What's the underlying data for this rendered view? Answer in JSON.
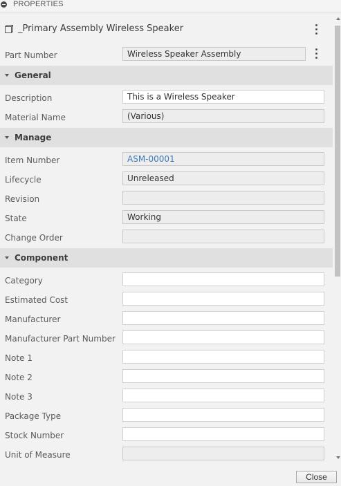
{
  "panel": {
    "title": "PROPERTIES",
    "assembly_name": "_Primary Assembly Wireless Speaker"
  },
  "part_number": {
    "label": "Part Number",
    "value": "Wireless Speaker Assembly"
  },
  "sections": {
    "general": {
      "title": "General",
      "description": {
        "label": "Description",
        "value": "This is a Wireless Speaker"
      },
      "material_name": {
        "label": "Material Name",
        "value": "(Various)"
      }
    },
    "manage": {
      "title": "Manage",
      "item_number": {
        "label": "Item Number",
        "value": "ASM-00001"
      },
      "lifecycle": {
        "label": "Lifecycle",
        "value": "Unreleased"
      },
      "revision": {
        "label": "Revision",
        "value": ""
      },
      "state": {
        "label": "State",
        "value": "Working"
      },
      "change_order": {
        "label": "Change Order",
        "value": ""
      }
    },
    "component": {
      "title": "Component",
      "category": {
        "label": "Category",
        "value": ""
      },
      "estimated_cost": {
        "label": "Estimated Cost",
        "value": ""
      },
      "manufacturer": {
        "label": "Manufacturer",
        "value": ""
      },
      "manufacturer_part_number": {
        "label": "Manufacturer Part Number",
        "value": ""
      },
      "note_1": {
        "label": "Note 1",
        "value": ""
      },
      "note_2": {
        "label": "Note 2",
        "value": ""
      },
      "note_3": {
        "label": "Note 3",
        "value": ""
      },
      "package_type": {
        "label": "Package Type",
        "value": ""
      },
      "stock_number": {
        "label": "Stock Number",
        "value": ""
      },
      "unit_of_measure": {
        "label": "Unit of Measure",
        "value": ""
      }
    }
  },
  "footer": {
    "close_label": "Close"
  },
  "colors": {
    "link": "#3d7ab8",
    "section_bg": "#e0e0e0",
    "panel_bg": "#f2f2f2"
  }
}
